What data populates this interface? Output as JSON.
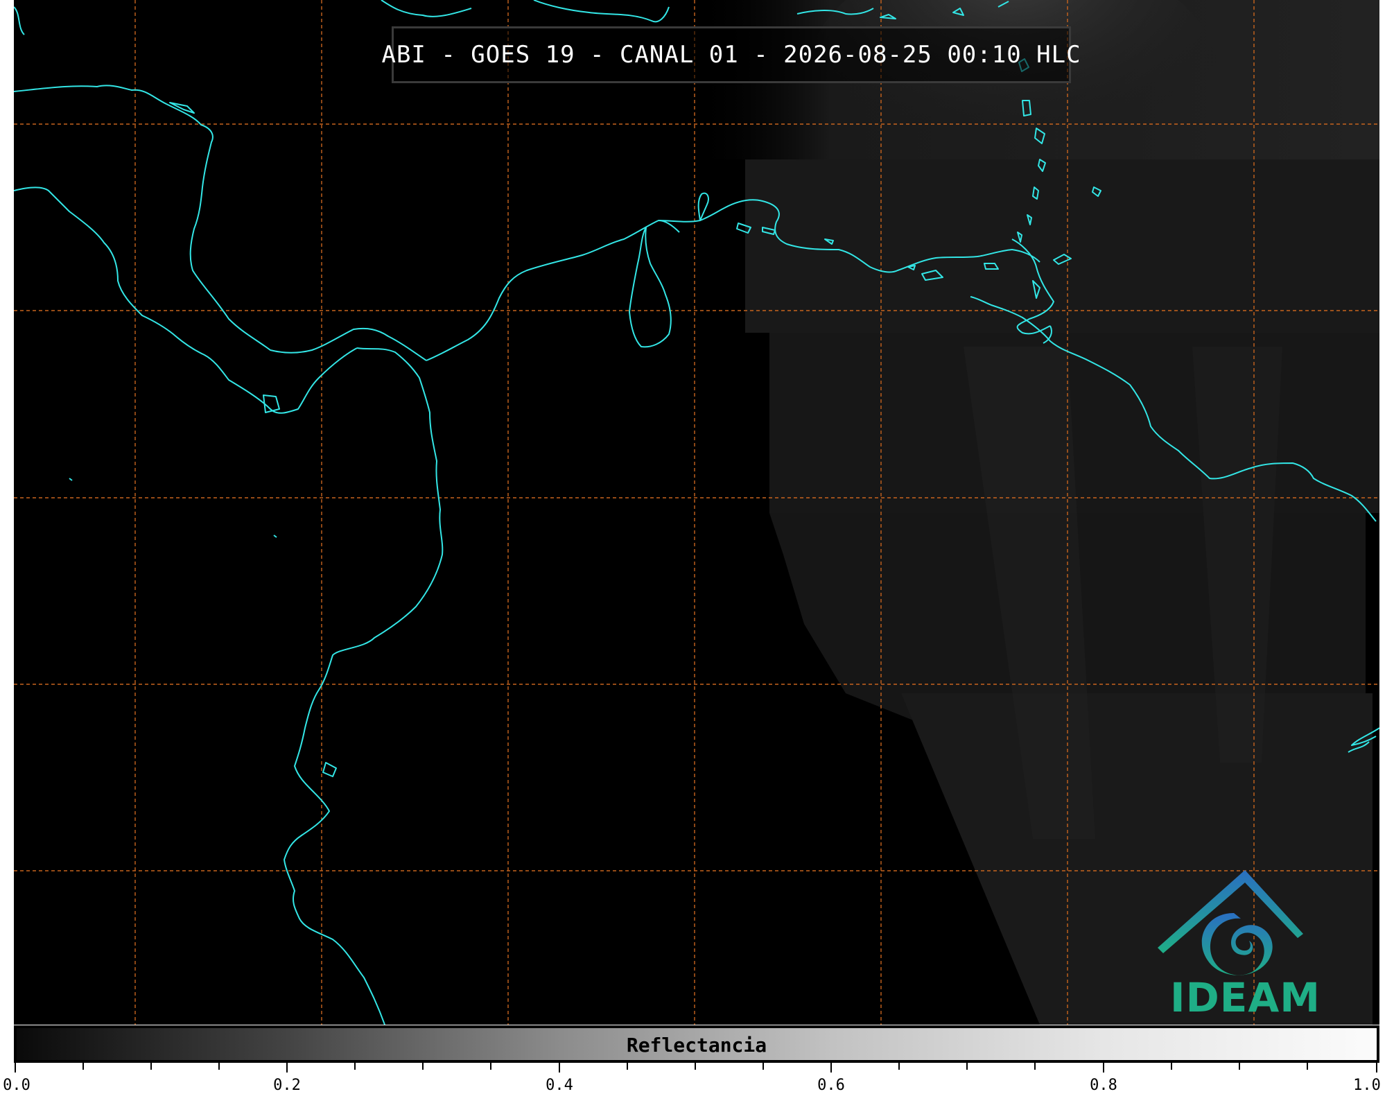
{
  "title": "ABI - GOES 19 - CANAL 01 - 2026-08-25 00:10 HLC",
  "logo_text": "IDEAM",
  "colorbar": {
    "label": "Reflectancia",
    "range": [
      0.0,
      1.0
    ],
    "tick_labels": [
      "0.0",
      "0.2",
      "0.4",
      "0.6",
      "0.8",
      "1.0"
    ]
  },
  "colors": {
    "coastline": "#33e6e6",
    "graticule": "#c8641e",
    "background": "#000000",
    "logo_blue": "#2a6fc2",
    "logo_green": "#1fae86"
  }
}
